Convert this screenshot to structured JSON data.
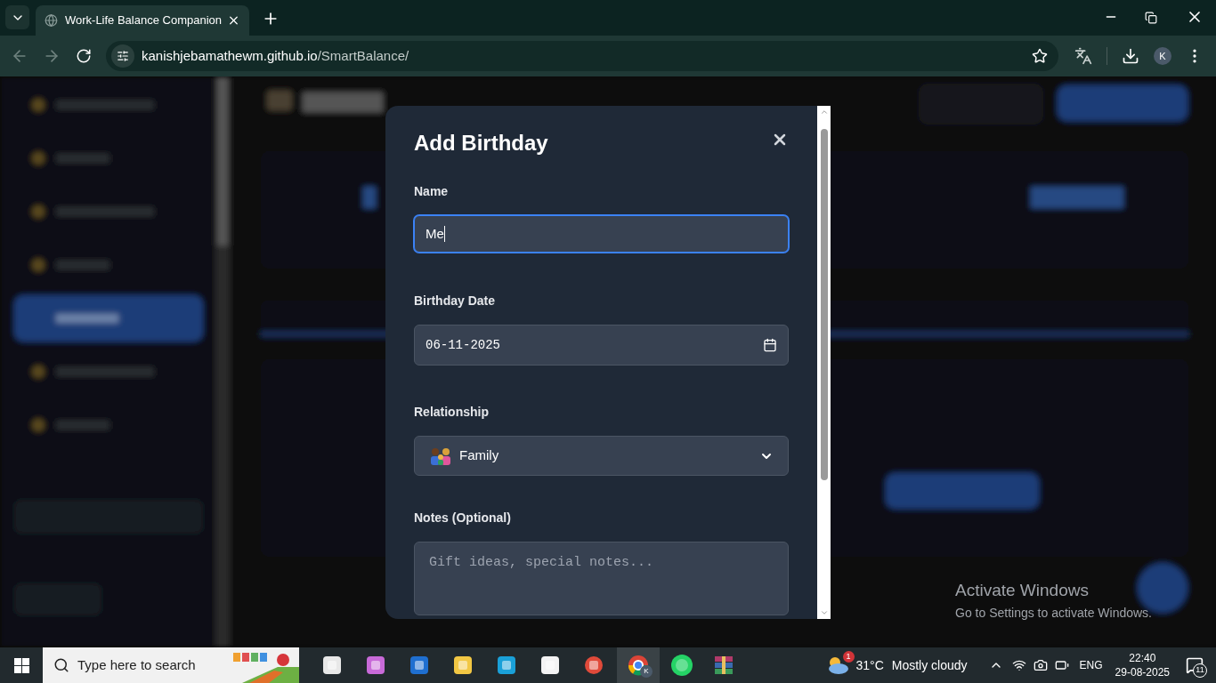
{
  "browser": {
    "tab_title": "Work-Life Balance Companion",
    "url_host": "kanishjebamathewm.github.io",
    "url_path": "/SmartBalance/",
    "profile": "K"
  },
  "modal": {
    "title": "Add Birthday",
    "fields": [
      {
        "kind": "text",
        "label": "Name",
        "value": "Me",
        "focused": true
      },
      {
        "kind": "date",
        "label": "Birthday Date",
        "value": "06-11-2025",
        "focused": false
      },
      {
        "kind": "select",
        "label": "Relationship",
        "value": "Family",
        "focused": false
      },
      {
        "kind": "textarea",
        "label": "Notes (Optional)",
        "placeholder": "Gift ideas, special notes...",
        "focused": false
      }
    ]
  },
  "watermark": {
    "title": "Activate Windows",
    "subtitle": "Go to Settings to activate Windows."
  },
  "taskbar": {
    "search_placeholder": "Type here to search",
    "chrome_profile": "K",
    "weather_badge": "1",
    "temperature": "31°C",
    "condition": "Mostly cloudy",
    "language": "ENG",
    "time": "22:40",
    "date": "29-08-2025",
    "notifications": "11"
  }
}
